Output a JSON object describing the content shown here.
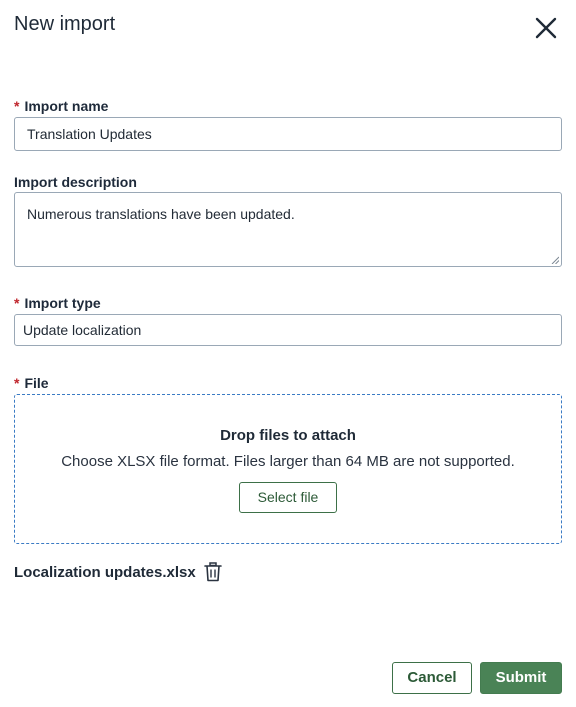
{
  "dialog": {
    "title": "New import"
  },
  "form": {
    "required_marker": "*",
    "import_name": {
      "label": "Import name",
      "value": "Translation Updates"
    },
    "import_description": {
      "label": "Import description",
      "value": "Numerous translations have been updated."
    },
    "import_type": {
      "label": "Import type",
      "value": "Update localization"
    },
    "file": {
      "label": "File",
      "drop_title": "Drop files to attach",
      "drop_hint": "Choose XLSX file format. Files larger than 64 MB are not supported.",
      "select_button": "Select file",
      "attached_file": "Localization updates.xlsx"
    }
  },
  "footer": {
    "cancel_label": "Cancel",
    "submit_label": "Submit"
  },
  "colors": {
    "accent_green": "#4a8356",
    "required_red": "#c0262d",
    "dropzone_border": "#3b7bc4"
  }
}
